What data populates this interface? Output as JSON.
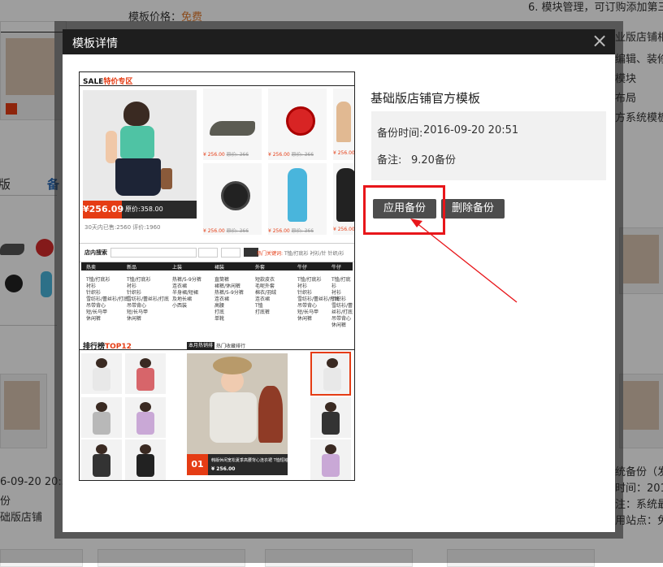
{
  "background": {
    "price_label": "模板价格：",
    "price_value": "免费",
    "top_right_text": "6. 模块管理，可订购添加第三方",
    "right_lines": [
      "业版店铺相",
      "编辑、装修",
      "模块",
      "布局",
      "方系统模板"
    ],
    "left_tabs": [
      "版",
      "备"
    ],
    "bottom_left_lines": [
      "6-09-20 20:51",
      "份",
      "础版店铺"
    ],
    "bottom_right_lines": [
      "统备份（发",
      "时间：201",
      "注：系统最",
      "用站点：免"
    ]
  },
  "modal": {
    "title": "模板详情",
    "close_symbol": "×",
    "template_name": "基础版店铺官方模板",
    "backup_time_label": "备份时间:",
    "backup_time_value": "2016-09-20 20:51",
    "note_label": "备注:",
    "note_value": "9.20备份",
    "apply_button": "应用备份",
    "delete_button": "删除备份"
  },
  "preview": {
    "sale_title": "SALE",
    "sale_subtitle": "特价专区",
    "main_price": "¥256.09",
    "main_orig": "原价:358.00",
    "sold_text": "30天内已售:2560   评价:1960",
    "product_price": "¥ 256.00",
    "product_orig": "原价: 366",
    "search_label": "店内搜索",
    "hot_label": "热门关键词:",
    "hot_words": "T恤/打底衫  衬衫/针  针织/衫",
    "categories": [
      "热卖",
      "新品",
      "上装",
      "裙装",
      "外套",
      "牛仔",
      "牛仔"
    ],
    "cat_col1": [
      "T恤/打底衫",
      "衬衫",
      "针织衫",
      "雪纺衫/蕾丝衫/打底",
      "吊带背心",
      "短/长马甲",
      "休闲裤"
    ],
    "cat_col2": [
      "T恤/打底衫",
      "衬衫",
      "针织衫",
      "雪纺衫/蕾丝衫/打底",
      "吊带背心",
      "短/长马甲",
      "休闲裤"
    ],
    "cat_col3": [
      "热裤/5-9分裤",
      "连衣裙",
      "半身裙/短裙",
      "及地长裙",
      "小西装"
    ],
    "cat_col4": [
      "直筒裤",
      "裙裤/休闲裤",
      "热裤/5-9分裤",
      "连衣裙",
      "高腰",
      "打底",
      "单靴"
    ],
    "cat_col5": [
      "短款皮衣",
      "毛呢外套",
      "棉衣/羽绒",
      "连衣裙",
      "T恤",
      "打底裤"
    ],
    "cat_col6": [
      "T恤/打底衫",
      "衬衫",
      "针织衫",
      "雪纺衫/蕾丝衫/打底",
      "吊带背心",
      "短/长马甲",
      "休闲裤"
    ],
    "cat_col7": [
      "T恤/打底衫",
      "衬衫",
      "针织衫",
      "雪纺衫/蕾丝衫/打底",
      "吊带背心",
      "休闲裤"
    ],
    "rank_title": "排行榜",
    "rank_top": "TOP12",
    "rank_tab1": "本月热销排行",
    "rank_tab2": "热门收藏排行",
    "rank_num": "01",
    "rank_desc": "韩版休闲宽松夏季高腰背心连衣裙 T恤短袖",
    "rank_price": "¥ 256.00"
  },
  "colors": {
    "accent_red": "#e53c14",
    "highlight_red": "#e8161a",
    "button_gray": "#4d4d4d",
    "header_dark": "#1e1e1e"
  }
}
